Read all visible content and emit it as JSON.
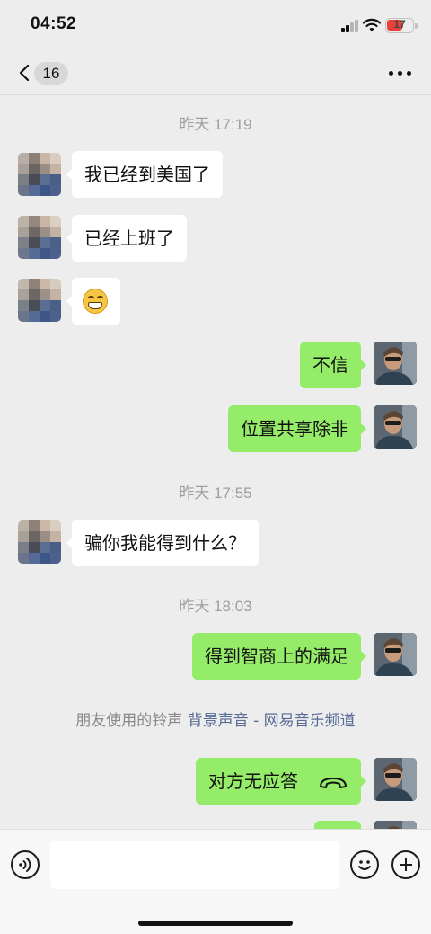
{
  "status_bar": {
    "time": "04:52",
    "battery": "17",
    "icons": [
      "cellular-signal-icon",
      "wifi-icon",
      "battery-icon"
    ]
  },
  "nav": {
    "unread_count": "16",
    "icons": [
      "chevron-left-icon",
      "more-icon"
    ]
  },
  "timestamps": [
    "昨天 17:19",
    "昨天 17:55",
    "昨天 18:03"
  ],
  "messages": [
    {
      "from": "friend",
      "text": "我已经到美国了"
    },
    {
      "from": "friend",
      "text": "已经上班了"
    },
    {
      "from": "friend",
      "type": "emoji",
      "icon": "grinning-face-emoji"
    },
    {
      "from": "me",
      "text": "不信"
    },
    {
      "from": "me",
      "text": "位置共享除非"
    },
    {
      "from": "friend",
      "text": "骗你我能得到什么？"
    },
    {
      "from": "me",
      "text": "得到智商上的满足"
    },
    {
      "from": "me",
      "text": "对方无应答",
      "icon": "hang-up-icon"
    }
  ],
  "ringtone": {
    "prefix": "朋友使用的铃声 ",
    "link": "背景声音 - 网易音乐频道"
  },
  "input": {
    "placeholder": "",
    "icons": [
      "voice-icon",
      "emoji-icon",
      "plus-icon"
    ]
  },
  "colors": {
    "background": "#ededed",
    "my_bubble": "#95ec69",
    "friend_bubble": "#ffffff",
    "link": "#576b95",
    "battery_low": "#e8413a"
  }
}
